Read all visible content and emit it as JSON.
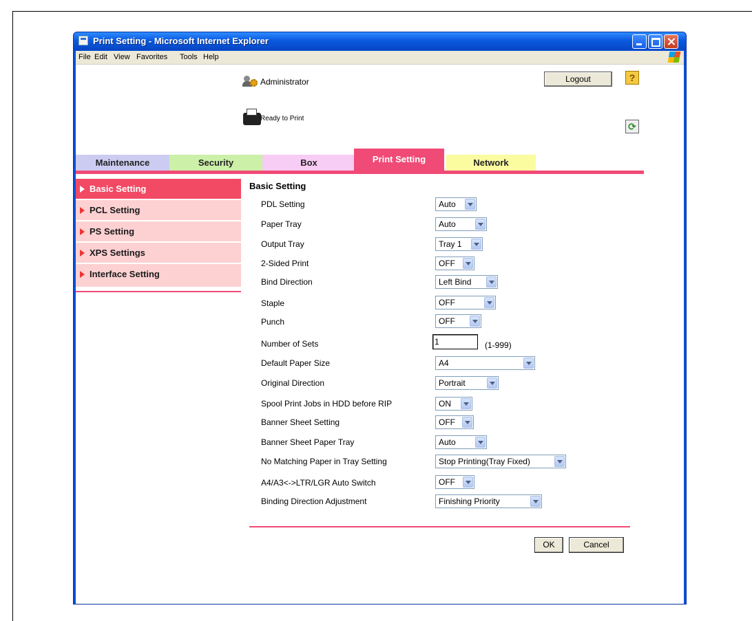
{
  "window": {
    "title": "Print Setting - Microsoft Internet Explorer"
  },
  "menu": [
    "File",
    "Edit",
    "View",
    "Favorites",
    "Tools",
    "Help"
  ],
  "header": {
    "user": "Administrator",
    "logout_label": "Logout",
    "help_label": "?",
    "status": "Ready to Print"
  },
  "tabs": [
    "Maintenance",
    "Security",
    "Box",
    "Print Setting",
    "Network"
  ],
  "active_tab": "Print Setting",
  "sidebar": {
    "items": [
      "Basic Setting",
      "PCL Setting",
      "PS Setting",
      "XPS Settings",
      "Interface Setting"
    ],
    "active": "Basic Setting"
  },
  "main": {
    "title": "Basic Setting",
    "settings": [
      {
        "label": "PDL Setting",
        "value": "Auto"
      },
      {
        "label": "Paper Tray",
        "value": "Auto"
      },
      {
        "label": "Output Tray",
        "value": "Tray 1"
      },
      {
        "label": "2-Sided Print",
        "value": "OFF"
      },
      {
        "label": "Bind Direction",
        "value": "Left Bind"
      },
      {
        "label": "Staple",
        "value": "OFF"
      },
      {
        "label": "Punch",
        "value": "OFF"
      },
      {
        "label": "Number of Sets",
        "value": "1",
        "hint": "(1-999)"
      },
      {
        "label": "Default Paper Size",
        "value": "A4"
      },
      {
        "label": "Original Direction",
        "value": "Portrait"
      },
      {
        "label": "Spool Print Jobs in HDD before RIP",
        "value": "ON"
      },
      {
        "label": "Banner Sheet Setting",
        "value": "OFF"
      },
      {
        "label": "Banner Sheet Paper Tray",
        "value": "Auto"
      },
      {
        "label": "No Matching Paper in Tray Setting",
        "value": "Stop Printing(Tray Fixed)"
      },
      {
        "label": "A4/A3<->LTR/LGR Auto Switch",
        "value": "OFF"
      },
      {
        "label": "Binding Direction Adjustment",
        "value": "Finishing Priority"
      }
    ]
  },
  "buttons": {
    "ok": "OK",
    "cancel": "Cancel"
  },
  "colors": {
    "accent": "#f04a76",
    "sidebar_bg": "#fdd0d2",
    "tab_maintenance": "#ccccf2",
    "tab_security": "#ccf0a8",
    "tab_box": "#f7ccf5",
    "tab_network": "#fbfba0"
  }
}
